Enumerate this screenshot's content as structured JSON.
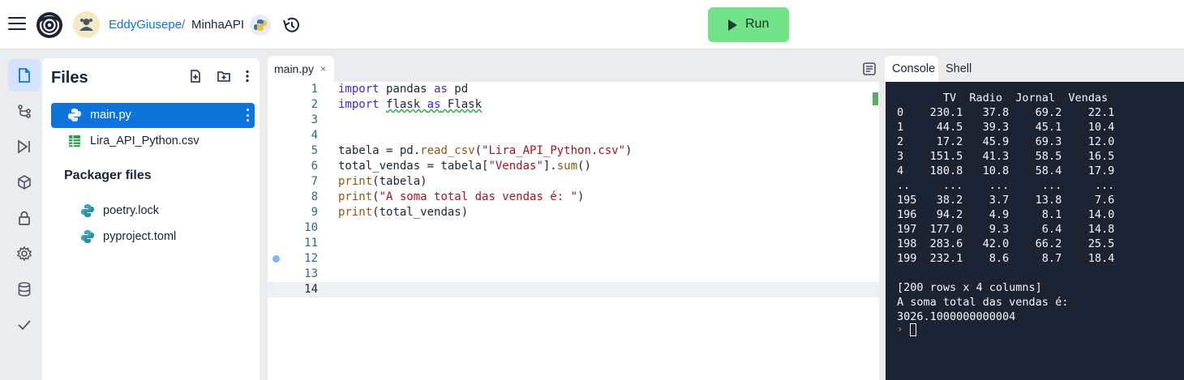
{
  "topbar": {
    "user": "EddyGiusepe",
    "separator": "/",
    "project": "MinhaAPI",
    "run_label": "Run",
    "run_color": "#73e389"
  },
  "rail": {
    "items": [
      "file-icon",
      "git-branch-icon",
      "debugger-icon",
      "package-icon",
      "lock-icon",
      "gear-icon",
      "database-icon",
      "check-icon"
    ]
  },
  "files": {
    "title": "Files",
    "items": [
      {
        "name": "main.py",
        "icon": "python-icon",
        "active": true
      },
      {
        "name": "Lira_API_Python.csv",
        "icon": "spreadsheet-icon",
        "active": false
      }
    ],
    "packager_title": "Packager files",
    "packager_items": [
      {
        "name": "poetry.lock",
        "icon": "python-icon"
      },
      {
        "name": "pyproject.toml",
        "icon": "python-icon"
      }
    ]
  },
  "editor": {
    "tab_label": "main.py",
    "tab_close": "×",
    "line_numbers": [
      "1",
      "2",
      "3",
      "4",
      "5",
      "6",
      "7",
      "8",
      "9",
      "10",
      "11",
      "12",
      "13",
      "14"
    ],
    "lines": [
      "import pandas as pd",
      "import flask as Flask",
      "",
      "",
      "tabela = pd.read_csv(\"Lira_API_Python.csv\")",
      "total_vendas = tabela[\"Vendas\"].sum()",
      "print(tabela)",
      "print(\"A soma total das vendas é: \")",
      "print(total_vendas)",
      "",
      "",
      "",
      "",
      ""
    ]
  },
  "console": {
    "tab_console": "Console",
    "tab_shell": "Shell",
    "output": [
      "       TV  Radio  Jornal  Vendas",
      "0    230.1   37.8    69.2    22.1",
      "1     44.5   39.3    45.1    10.4",
      "2     17.2   45.9    69.3    12.0",
      "3    151.5   41.3    58.5    16.5",
      "4    180.8   10.8    58.4    17.9",
      "..     ...    ...     ...     ...",
      "195   38.2    3.7    13.8     7.6",
      "196   94.2    4.9     8.1    14.0",
      "197  177.0    9.3     6.4    14.8",
      "198  283.6   42.0    66.2    25.5",
      "199  232.1    8.6     8.7    18.4",
      "",
      "[200 rows x 4 columns]",
      "A soma total das vendas é:",
      "3026.1000000000004"
    ],
    "prompt": "›"
  }
}
